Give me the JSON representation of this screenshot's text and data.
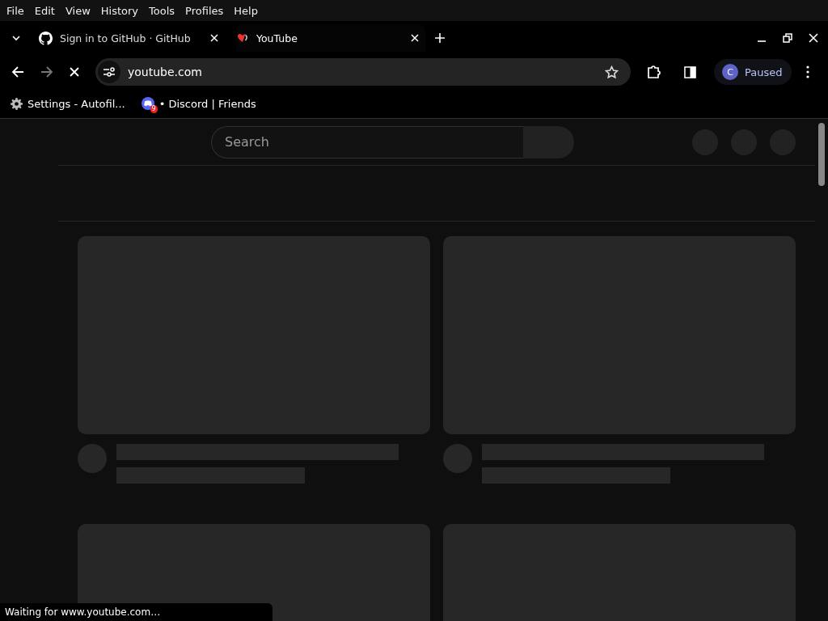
{
  "menu": [
    "File",
    "Edit",
    "View",
    "History",
    "Tools",
    "Profiles",
    "Help"
  ],
  "tabs": [
    {
      "title": "Sign in to GitHub · GitHub",
      "kind": "github",
      "selected": false
    },
    {
      "title": "YouTube",
      "kind": "youtube",
      "selected": true
    }
  ],
  "toolbar": {
    "address": "youtube.com",
    "loading": true,
    "profile": {
      "initial": "C",
      "status": "Paused"
    }
  },
  "bookmarks": [
    {
      "label": "Settings - Autofil...",
      "kind": "settings"
    },
    {
      "label": "• Discord | Friends",
      "kind": "discord",
      "badge": "9"
    }
  ],
  "page": {
    "search": {
      "placeholder": "Search"
    },
    "video_cards": [
      {
        "kind": "placeholder"
      },
      {
        "kind": "placeholder"
      },
      {
        "kind": "thumbnail"
      },
      {
        "kind": "thumbnail"
      }
    ]
  },
  "status_bar": "Waiting for www.youtube.com…"
}
